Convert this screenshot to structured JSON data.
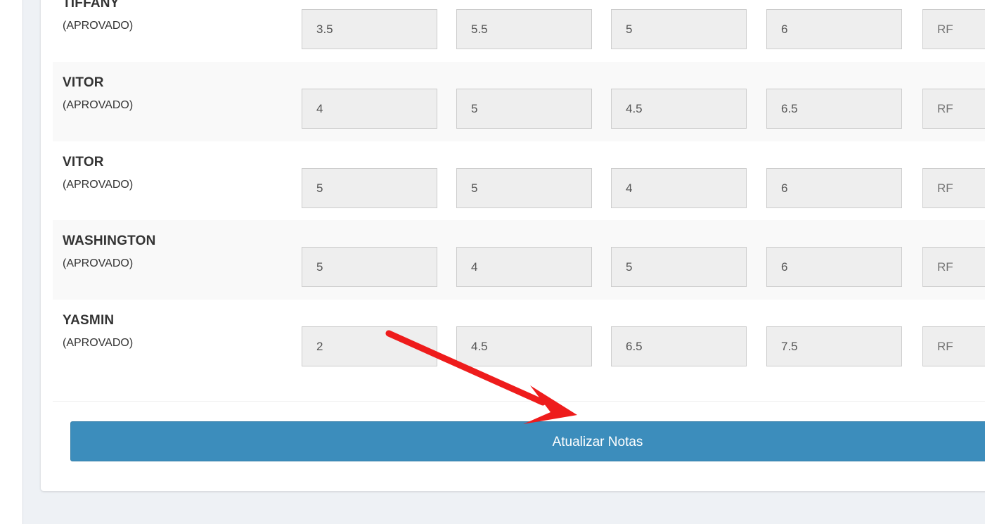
{
  "students": [
    {
      "name": "TIFFANY",
      "status": "(APROVADO)",
      "grades": [
        "3.5",
        "5.5",
        "5",
        "6"
      ],
      "rf_placeholder": "RF"
    },
    {
      "name": "VITOR",
      "status": "(APROVADO)",
      "grades": [
        "4",
        "5",
        "4.5",
        "6.5"
      ],
      "rf_placeholder": "RF"
    },
    {
      "name": "VITOR",
      "status": "(APROVADO)",
      "grades": [
        "5",
        "5",
        "4",
        "6"
      ],
      "rf_placeholder": "RF"
    },
    {
      "name": "WASHINGTON",
      "status": "(APROVADO)",
      "grades": [
        "5",
        "4",
        "5",
        "6"
      ],
      "rf_placeholder": "RF"
    },
    {
      "name": "YASMIN",
      "status": "(APROVADO)",
      "grades": [
        "2",
        "4.5",
        "6.5",
        "7.5"
      ],
      "rf_placeholder": "RF"
    }
  ],
  "actions": {
    "update_label": "Atualizar Notas"
  },
  "colors": {
    "primary_button": "#3c8dbc",
    "annotation_arrow": "#ee1c1c"
  }
}
